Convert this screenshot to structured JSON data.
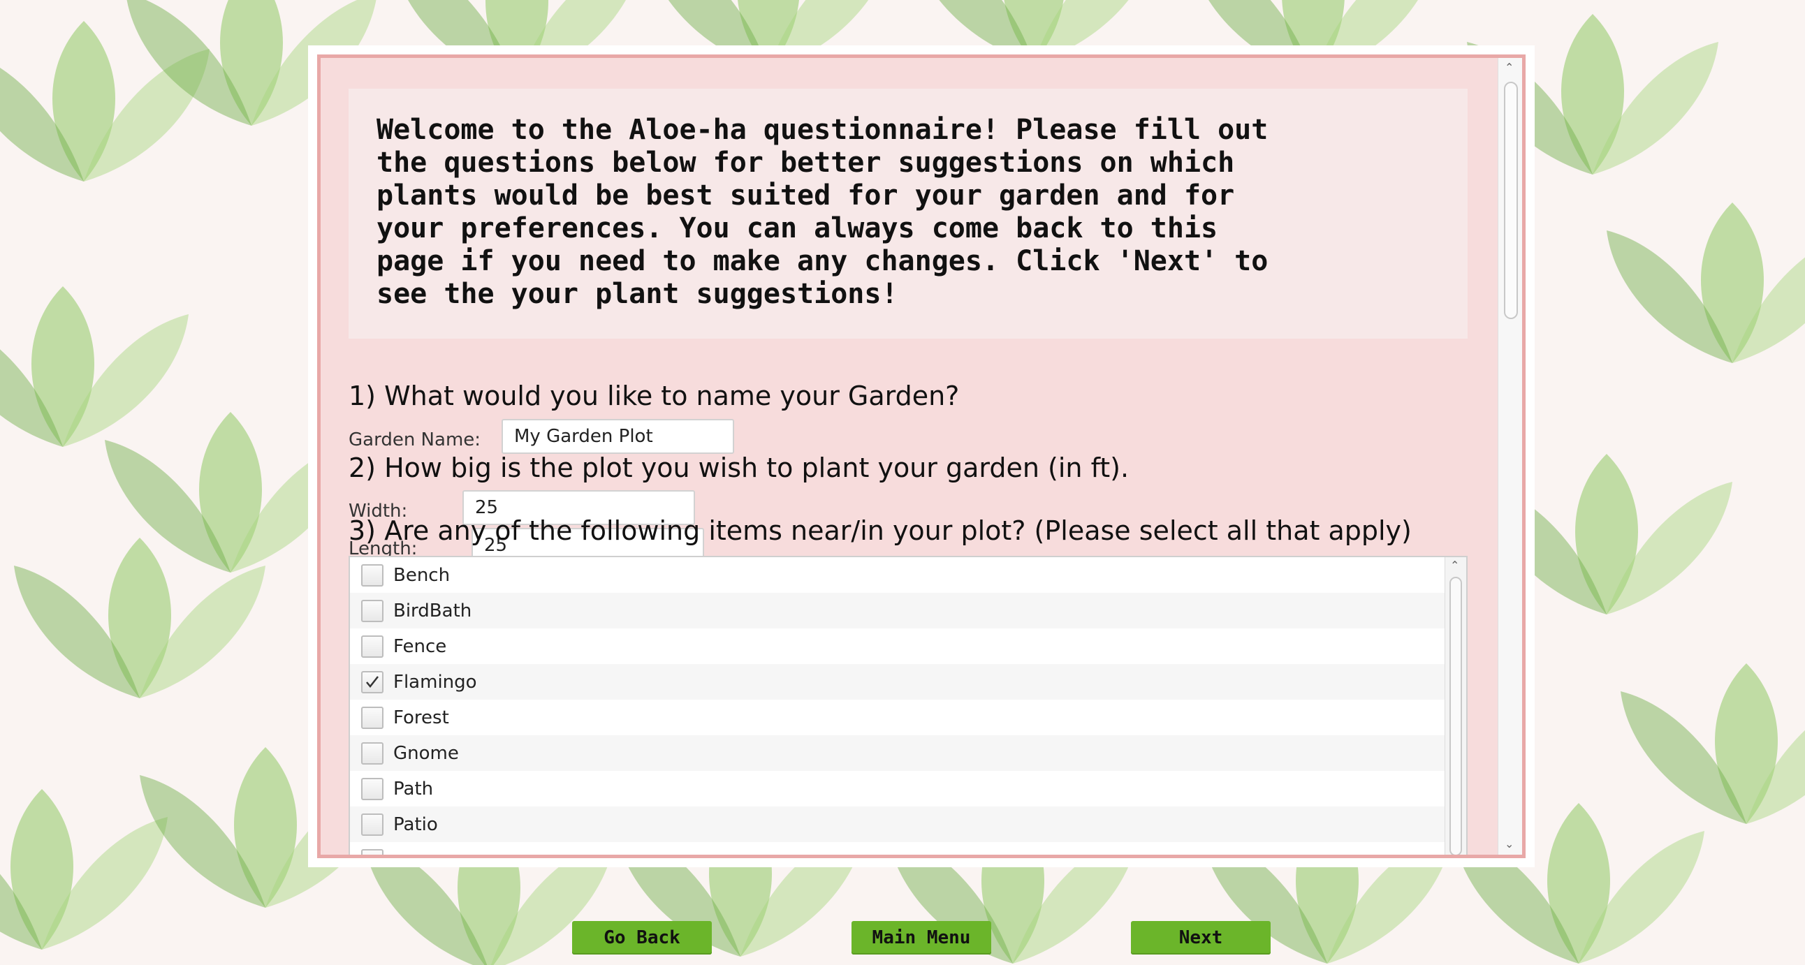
{
  "intro": {
    "text": "Welcome to the Aloe-ha questionnaire! Please fill out\nthe questions below for better suggestions on which\nplants would be best suited for your garden and for\nyour preferences. You can always come back to this\npage if you need to make any changes. Click 'Next' to\nsee the your plant suggestions!"
  },
  "q1": {
    "title": "1) What would you like to name your Garden?",
    "name_label": "Garden Name:",
    "name_value": "My Garden Plot"
  },
  "q2": {
    "title": "2) How big is the plot you wish to plant your garden (in ft).",
    "width_label": "Width:",
    "width_value": "25",
    "length_label": "Length:",
    "length_value": "25"
  },
  "q3": {
    "title": "3) Are any of the following items near/in your plot? (Please select all that apply)",
    "items": [
      {
        "label": "Bench",
        "checked": false
      },
      {
        "label": "BirdBath",
        "checked": false
      },
      {
        "label": "Fence",
        "checked": false
      },
      {
        "label": "Flamingo",
        "checked": true
      },
      {
        "label": "Forest",
        "checked": false
      },
      {
        "label": "Gnome",
        "checked": false
      },
      {
        "label": "Path",
        "checked": false
      },
      {
        "label": "Patio",
        "checked": false
      }
    ]
  },
  "buttons": {
    "back": "Go Back",
    "menu": "Main Menu",
    "next": "Next"
  },
  "colors": {
    "button_green": "#6bb52a",
    "panel_pink": "#f7dcdc",
    "frame_border": "#e8a8a7"
  }
}
